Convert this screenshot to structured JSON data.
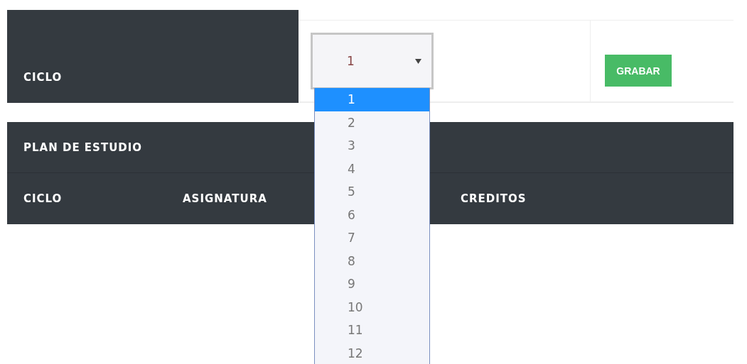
{
  "form": {
    "label": "CICLO",
    "select": {
      "value": "1",
      "expanded": true,
      "options": [
        {
          "label": "1",
          "selected": true
        },
        {
          "label": "2",
          "selected": false
        },
        {
          "label": "3",
          "selected": false
        },
        {
          "label": "4",
          "selected": false
        },
        {
          "label": "5",
          "selected": false
        },
        {
          "label": "6",
          "selected": false
        },
        {
          "label": "7",
          "selected": false
        },
        {
          "label": "8",
          "selected": false
        },
        {
          "label": "9",
          "selected": false
        },
        {
          "label": "10",
          "selected": false
        },
        {
          "label": "11",
          "selected": false
        },
        {
          "label": "12",
          "selected": false
        }
      ]
    },
    "button": "GRABAR"
  },
  "table": {
    "title": "PLAN DE ESTUDIO",
    "columns": [
      "CICLO",
      "ASIGNATURA",
      "CREDITOS"
    ]
  }
}
